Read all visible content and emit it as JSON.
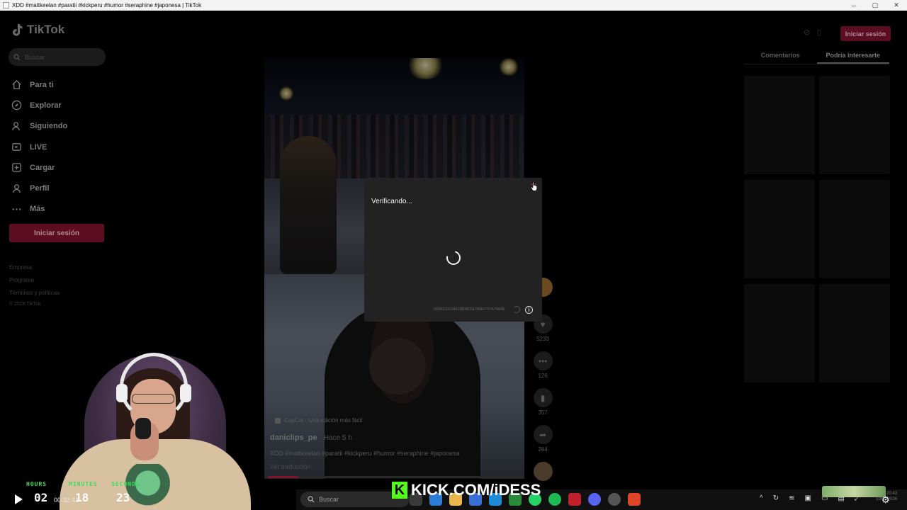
{
  "window": {
    "title": "XDD #mattkeelan #paratii #kickperu #humor #seraphine #japonesa | TikTok",
    "minimize": "─",
    "maximize": "▢",
    "close": "✕"
  },
  "brand": {
    "name": "TikTok"
  },
  "search": {
    "placeholder": "Buscar"
  },
  "nav": {
    "items": [
      {
        "label": "Para ti",
        "icon": "home-icon"
      },
      {
        "label": "Explorar",
        "icon": "compass-icon"
      },
      {
        "label": "Siguiendo",
        "icon": "following-icon"
      },
      {
        "label": "LIVE",
        "icon": "live-icon"
      },
      {
        "label": "Cargar",
        "icon": "upload-icon"
      },
      {
        "label": "Perfil",
        "icon": "profile-icon"
      },
      {
        "label": "Más",
        "icon": "more-icon"
      }
    ]
  },
  "login_label": "Iniciar sesión",
  "footer": {
    "links": [
      "Empresa",
      "Programa",
      "Términos y políticas"
    ],
    "copyright": "© 2026 TikTok"
  },
  "right_panel": {
    "tabs": [
      "Comentarios",
      "Podría interesarte"
    ],
    "active_tab": 1
  },
  "video": {
    "capcut": "CapCut · Una edición más fácil",
    "author": "daniclips_pe",
    "posted": "· Hace 5 h",
    "description": "XDD #mattkeelan #paratii #kickperu #humor #seraphine #japonesa",
    "translate": "Ver traducción",
    "progress": 0.12
  },
  "actions": {
    "likes": "5233",
    "comments": "126",
    "saves": "357",
    "shares": "284"
  },
  "modal": {
    "title": "Verificando...",
    "code": "20260210134011BD8C5E7B6EF767A706AB",
    "info": "i"
  },
  "stream": {
    "timer_labels": [
      "HOURS",
      "MINUTES",
      "SECONDS"
    ],
    "timer_values": [
      "02",
      "18",
      "23"
    ],
    "elapsed": "00:32:41",
    "kick_text": "KICK.COM/iDESS",
    "kick_logo": "K"
  },
  "taskbar": {
    "search_placeholder": "Buscar",
    "clock_time": "20:43",
    "clock_date": "10/02/2026"
  }
}
